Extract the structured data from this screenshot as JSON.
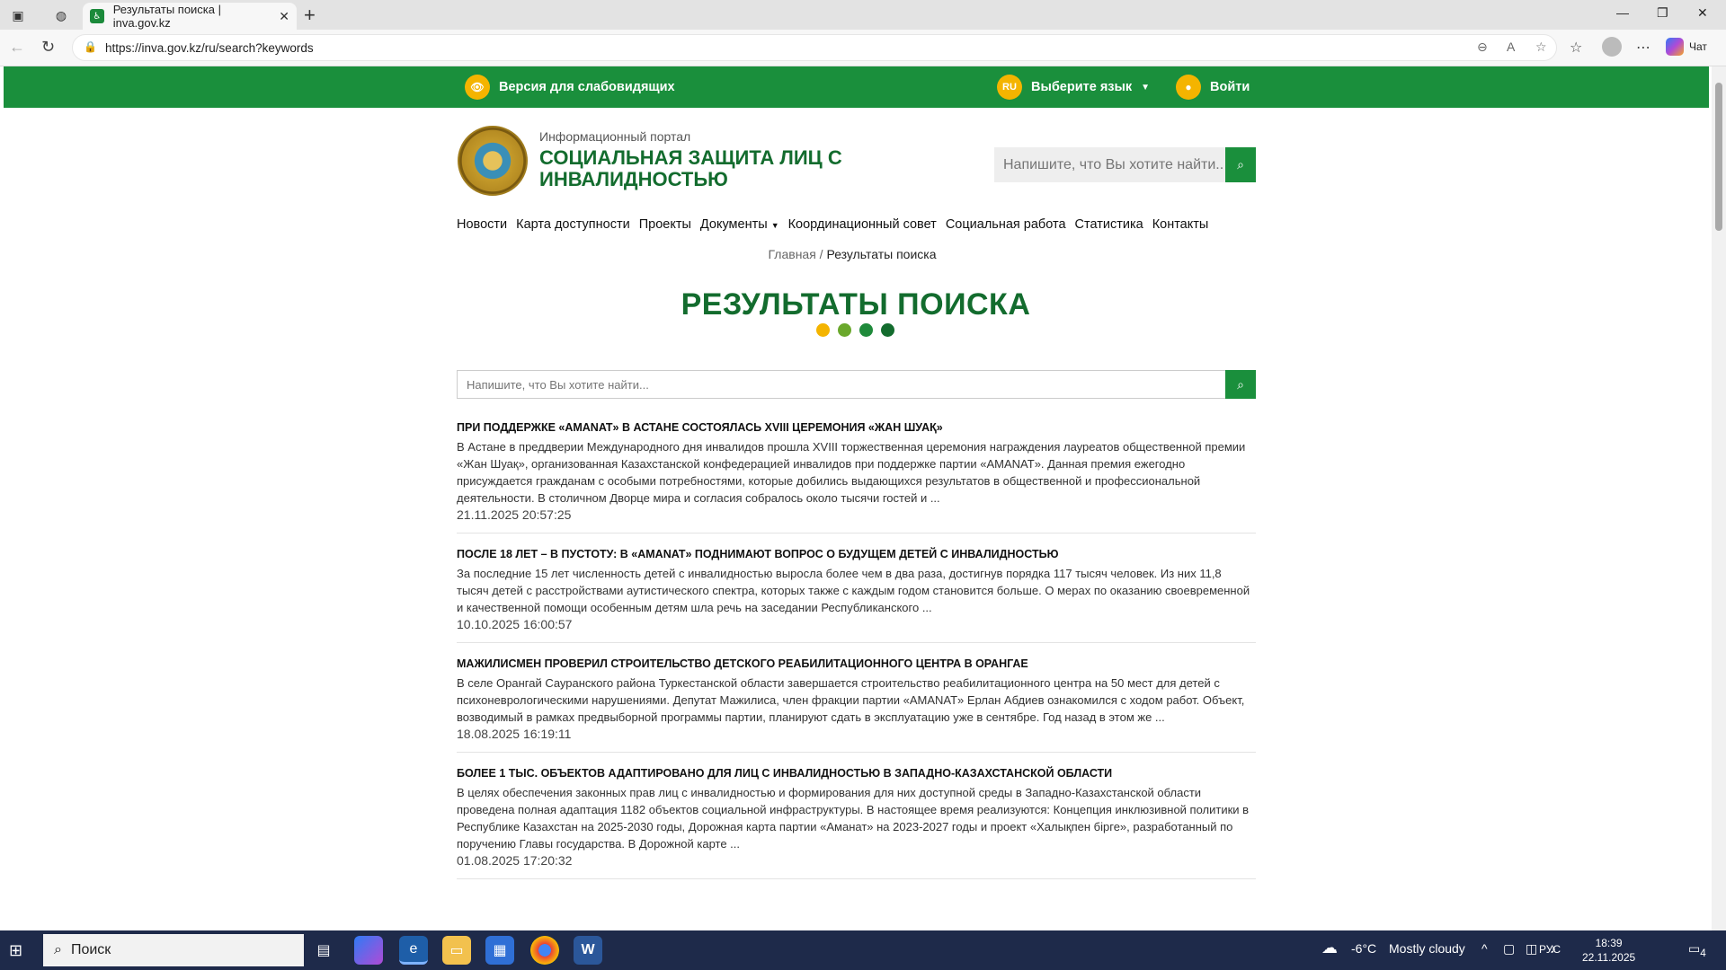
{
  "browser": {
    "tab_title": "Результаты поиска | inva.gov.kz",
    "url": "https://inva.gov.kz/ru/search?keywords",
    "copilot_label": "Чат"
  },
  "topbar": {
    "accessibility_label": "Версия для слабовидящих",
    "lang_code": "RU",
    "lang_label": "Выберите язык",
    "login_label": "Войти"
  },
  "header": {
    "subtitle": "Информационный портал",
    "title": "СОЦИАЛЬНАЯ ЗАЩИТА ЛИЦ С ИНВАЛИДНОСТЬЮ",
    "search_placeholder": "Напишите, что Вы хотите найти..."
  },
  "menu": [
    {
      "label": "Новости"
    },
    {
      "label": "Карта доступности"
    },
    {
      "label": "Проекты"
    },
    {
      "label": "Документы"
    },
    {
      "label": "Координационный совет"
    },
    {
      "label": "Социальная работа"
    },
    {
      "label": "Статистика"
    },
    {
      "label": "Контакты"
    }
  ],
  "breadcrumb": {
    "home": "Главная",
    "separator": " / ",
    "current": "Результаты поиска"
  },
  "page_title": "РЕЗУЛЬТАТЫ ПОИСКА",
  "dot_colors": [
    "#f4b400",
    "#6aa82c",
    "#1f8a3b",
    "#136c2e"
  ],
  "main_search": {
    "placeholder": "Напишите, что Вы хотите найти..."
  },
  "results": [
    {
      "title": "При поддержке «AMANAT» в Астане состоялась XVIII церемония «Жан Шуақ»",
      "excerpt": "В Астане в преддверии Международного дня инвалидов прошла XVIII торжественная церемония награждения лауреатов общественной премии «Жан Шуақ», организованная Казахстанской конфедерацией инвалидов при поддержке партии «AMANAT». Данная премия ежегодно присуждается гражданам с особыми потребностями, которые добились выдающихся результатов в общественной и профессиональной деятельности. В столичном Дворце мира и согласия собралось около тысячи гостей и ...",
      "date": "21.11.2025 20:57:25"
    },
    {
      "title": "После 18 лет – в пустоту: в «AMANAT» поднимают вопрос о будущем детей с инвалидностью",
      "excerpt": "За последние 15 лет численность детей с инвалидностью выросла более чем в два раза, достигнув порядка 117 тысяч человек. Из них 11,8 тысяч детей с расстройствами аутистического спектра, которых также с каждым годом становится больше. О мерах по оказанию своевременной и качественной помощи особенным детям шла речь на заседании Республиканского ...",
      "date": "10.10.2025 16:00:57"
    },
    {
      "title": "Мажилисмен проверил строительство детского реабилитационного центра в Орангае",
      "excerpt": "В селе Орангай Сауранского района Туркестанской области завершается строительство реабилитационного центра на 50 мест для детей с психоневрологическими нарушениями. Депутат Мажилиса, член фракции партии «AMANAT» Ерлан Абдиев ознакомился с ходом работ. Объект, возводимый в рамках предвыборной программы партии, планируют сдать в эксплуатацию уже в сентябре. Год назад в этом же ...",
      "date": "18.08.2025 16:19:11"
    },
    {
      "title": "Более 1 тыс. объектов адаптировано для лиц с инвалидностью в Западно-Казахстанской области",
      "excerpt": "В целях обеспечения законных прав лиц с инвалидностью и формирования для них доступной среды в Западно-Казахстанской области проведена полная адаптация 1182 объектов социальной инфраструктуры. В настоящее время реализуются: Концепция инклюзивной политики в Республике Казахстан на 2025-2030 годы, Дорожная карта партии «Аманат» на 2023-2027 годы и проект «Халықпен бірге», разработанный по поручению Главы государства. В Дорожной карте ...",
      "date": "01.08.2025 17:20:32"
    }
  ],
  "taskbar": {
    "search_label": "Поиск",
    "weather_temp": "-6°C",
    "weather_desc": "Mostly cloudy",
    "lang": "РУС",
    "time": "18:39",
    "date": "22.11.2025",
    "notif_count": "4"
  }
}
